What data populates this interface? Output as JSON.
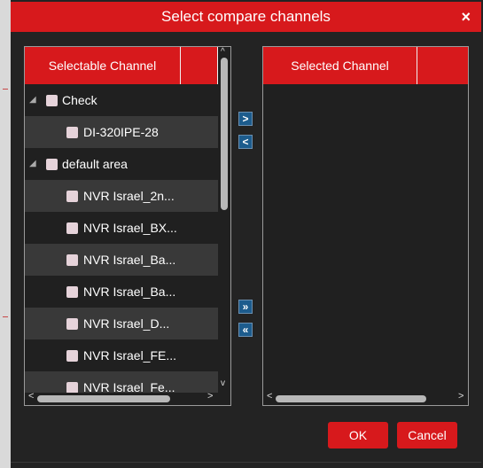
{
  "dialog": {
    "title": "Select compare channels",
    "close_label": "×"
  },
  "left_panel": {
    "header": "Selectable Channel",
    "rows": [
      {
        "label": "Check",
        "level": 0,
        "shaded": false
      },
      {
        "label": "DI-320IPE-28",
        "level": 1,
        "shaded": true
      },
      {
        "label": "default area",
        "level": 0,
        "shaded": false
      },
      {
        "label": "NVR Israel_2n...",
        "level": 1,
        "shaded": true
      },
      {
        "label": "NVR Israel_BX...",
        "level": 1,
        "shaded": false
      },
      {
        "label": "NVR Israel_Ba...",
        "level": 1,
        "shaded": true
      },
      {
        "label": "NVR Israel_Ba...",
        "level": 1,
        "shaded": false
      },
      {
        "label": "NVR Israel_D...",
        "level": 1,
        "shaded": true
      },
      {
        "label": "NVR Israel_FE...",
        "level": 1,
        "shaded": false
      },
      {
        "label": "NVR Israel_Fe...",
        "level": 1,
        "shaded": true
      }
    ],
    "expander_glyph": "◢"
  },
  "right_panel": {
    "header": "Selected Channel"
  },
  "move_buttons": {
    "add": ">",
    "remove": "<",
    "add_all": "»",
    "remove_all": "«"
  },
  "scroll_glyphs": {
    "up": "^",
    "down": "v",
    "left": "<",
    "right": ">"
  },
  "footer": {
    "ok": "OK",
    "cancel": "Cancel"
  },
  "colors": {
    "accent": "#d7191c",
    "panel_bg": "#202020",
    "row_shade": "#393939",
    "move_button": "#1d5c8d"
  }
}
